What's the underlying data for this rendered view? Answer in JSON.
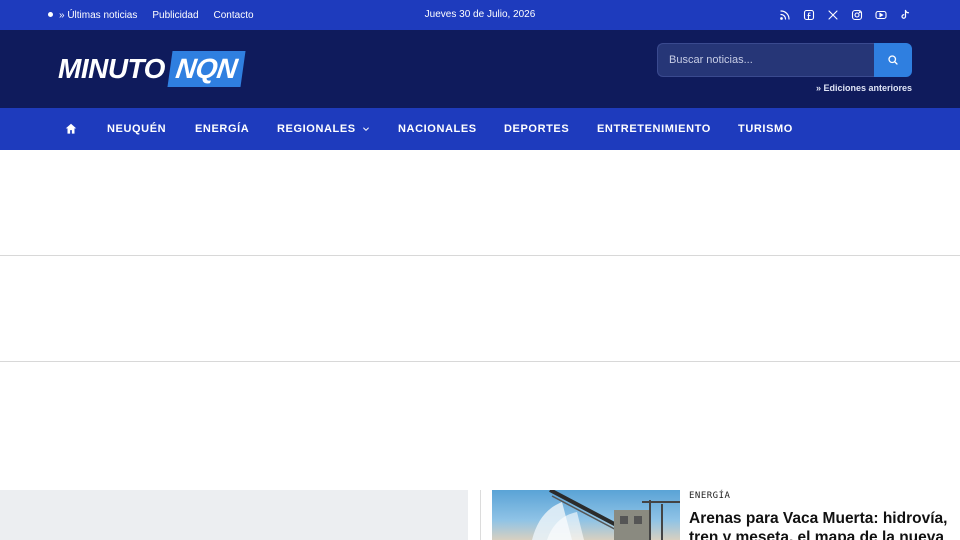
{
  "topbar": {
    "links": [
      "» Últimas noticias",
      "Publicidad",
      "Contacto"
    ],
    "date": "Jueves 30 de Julio, 2026",
    "social_icons": [
      "rss-icon",
      "facebook-icon",
      "x-icon",
      "instagram-icon",
      "youtube-icon",
      "tiktok-icon"
    ]
  },
  "header": {
    "logo_part1": "MINUTO",
    "logo_part2": "NQN",
    "search_placeholder": "Buscar noticias...",
    "editions_link": "» Ediciones anteriores"
  },
  "nav": {
    "items": [
      "NEUQUÉN",
      "ENERGÍA",
      "REGIONALES",
      "NACIONALES",
      "DEPORTES",
      "ENTRETENIMIENTO",
      "TURISMO"
    ]
  },
  "article": {
    "category": "ENERGÍA",
    "headline": "Arenas para Vaca Muerta: hidrovía, tren y meseta, el mapa de la nueva"
  },
  "colors": {
    "topbar": "#1e3bbd",
    "header": "#0f1b5c",
    "accent": "#2f7fe0"
  }
}
